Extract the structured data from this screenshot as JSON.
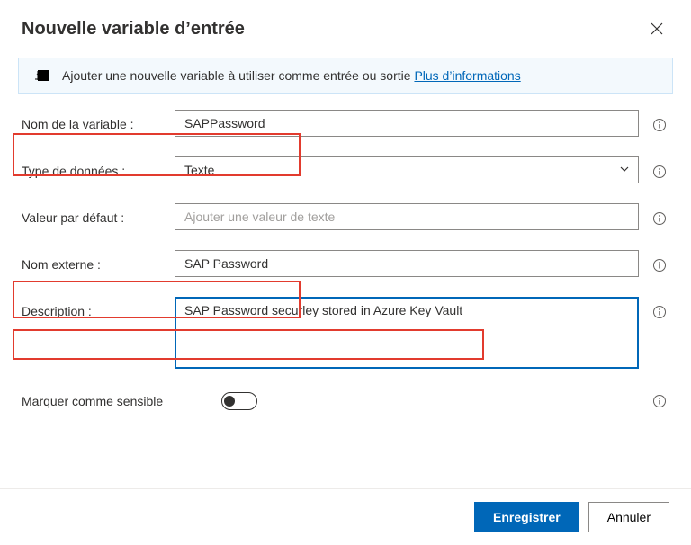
{
  "dialog": {
    "title": "Nouvelle variable d’entrée"
  },
  "infobar": {
    "message": "Ajouter une nouvelle variable à utiliser comme entrée ou sortie ",
    "link": "Plus d’informations"
  },
  "form": {
    "variable_name": {
      "label": "Nom de la variable :",
      "value": "SAPPassword"
    },
    "data_type": {
      "label": "Type de données :",
      "value": "Texte"
    },
    "default_value": {
      "label": "Valeur par défaut :",
      "placeholder": "Ajouter une valeur de texte",
      "value": ""
    },
    "external_name": {
      "label": "Nom externe :",
      "value": "SAP Password"
    },
    "description": {
      "label": "Description :",
      "value": "SAP Password securley stored in Azure Key Vault"
    },
    "sensitive": {
      "label": "Marquer comme sensible",
      "value": false
    }
  },
  "footer": {
    "save": "Enregistrer",
    "cancel": "Annuler"
  }
}
